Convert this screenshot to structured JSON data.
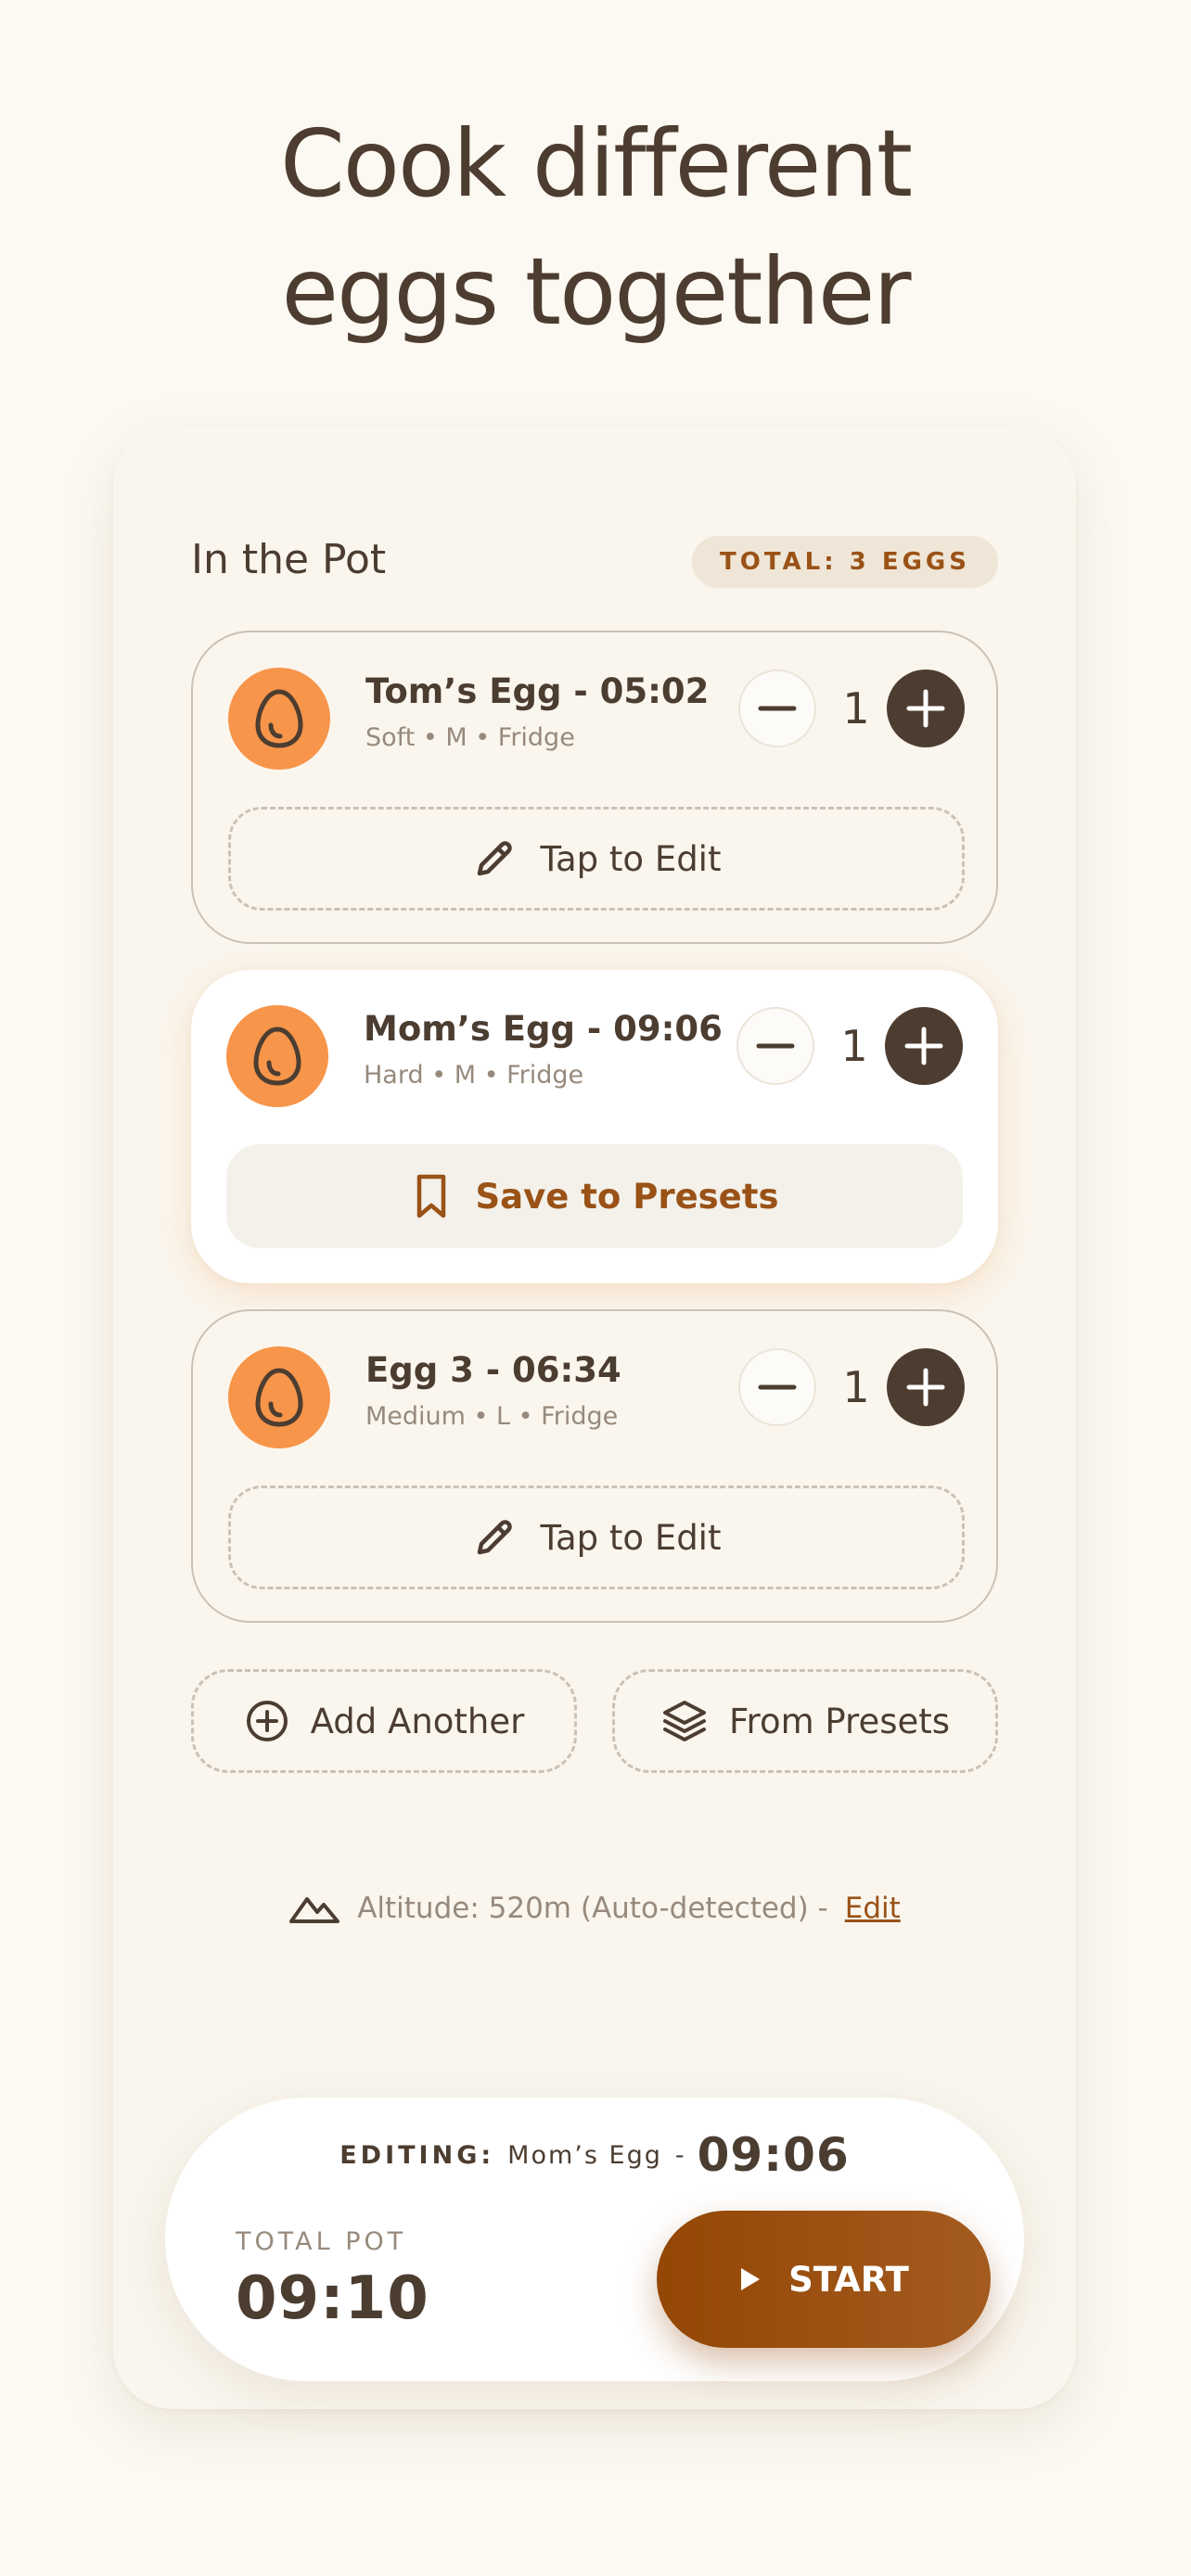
{
  "headline": {
    "line1": "Cook different",
    "line2": "eggs together"
  },
  "pot": {
    "title": "In the Pot",
    "total_badge": "TOTAL: 3 EGGS"
  },
  "eggs": [
    {
      "name": "Tom’s Egg - 05:02",
      "meta": "Soft • M • Fridge",
      "quantity": "1",
      "action_label": "Tap to Edit",
      "active": false
    },
    {
      "name": "Mom’s Egg - 09:06",
      "meta": "Hard • M • Fridge",
      "quantity": "1",
      "action_label": "Save to Presets",
      "active": true
    },
    {
      "name": "Egg 3 - 06:34",
      "meta": "Medium • L • Fridge",
      "quantity": "1",
      "action_label": "Tap to Edit",
      "active": false
    }
  ],
  "actions": {
    "add_another": "Add Another",
    "from_presets": "From Presets"
  },
  "altitude": {
    "text": "Altitude: 520m (Auto-detected) -",
    "edit_link": "Edit"
  },
  "bottom_bar": {
    "editing_label": "EDITING:",
    "editing_name": "Mom’s Egg",
    "editing_sep": "-",
    "editing_time": "09:06",
    "total_pot_label": "TOTAL POT",
    "total_pot_time": "09:10",
    "start_label": "START"
  },
  "colors": {
    "background": "#fcf9f2",
    "panel": "#faf6ee",
    "text_primary": "#4c3d31",
    "text_muted": "#978a7c",
    "accent_brown": "#9a5217",
    "egg_orange": "#f7954a",
    "dark_button": "#4d3d30"
  },
  "icons": {
    "egg": "egg-icon",
    "minus": "minus-icon",
    "plus": "plus-icon",
    "edit": "pencil-icon",
    "save": "bookmark-icon",
    "add": "plus-circle-icon",
    "presets": "layers-icon",
    "altitude": "mountain-icon",
    "start": "play-icon"
  }
}
